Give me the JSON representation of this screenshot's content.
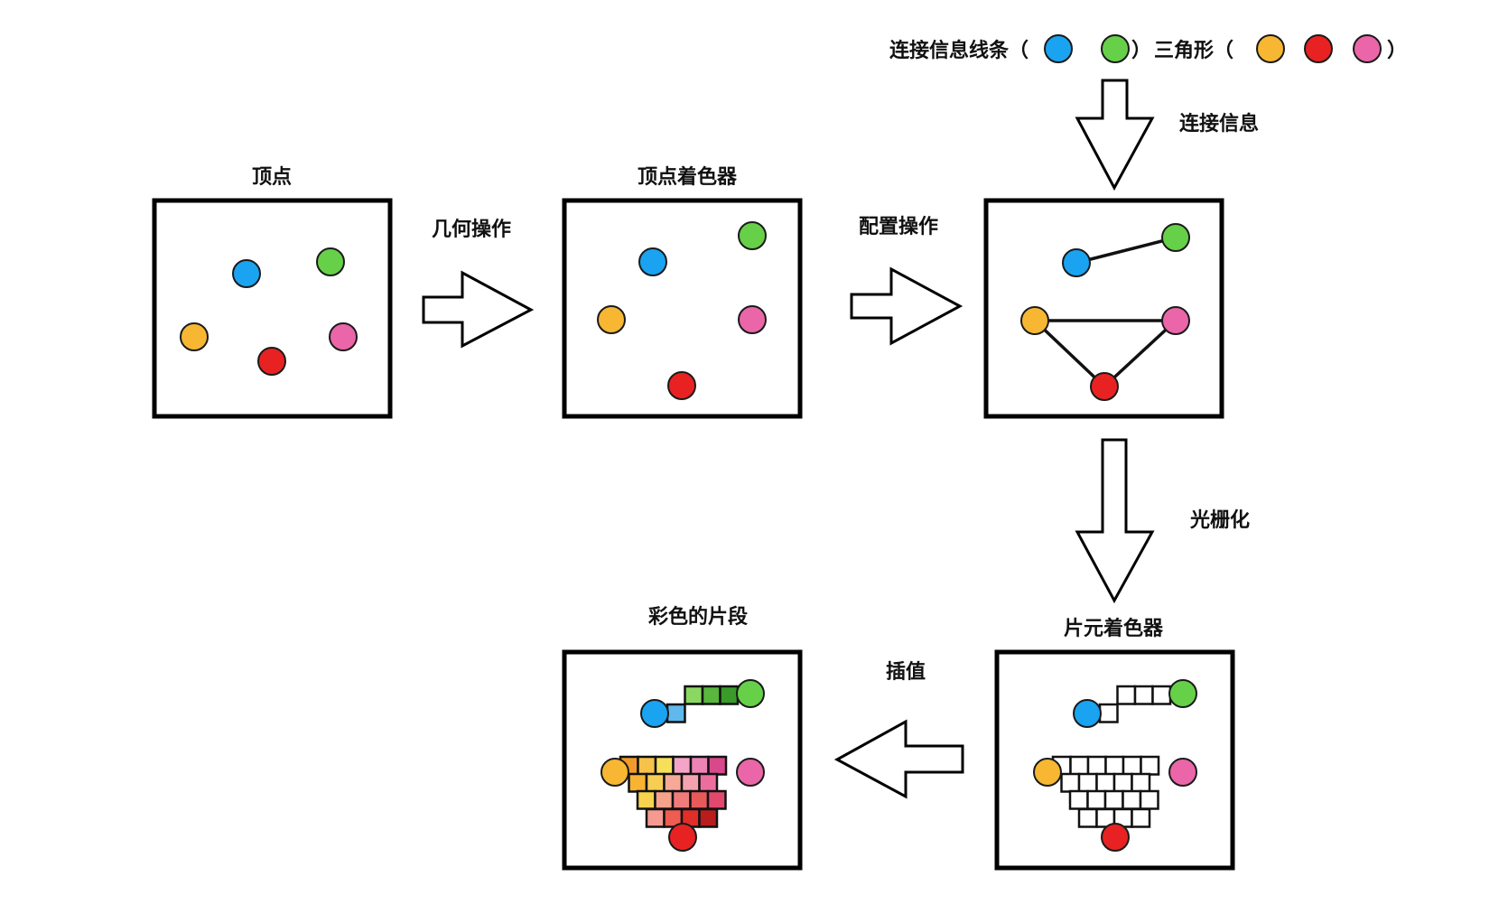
{
  "colors": {
    "blue": "#1aa3f0",
    "green": "#66d048",
    "orange": "#f7b733",
    "red": "#e82222",
    "pink": "#ea66a8"
  },
  "legend": {
    "lines_label": "连接信息线条（",
    "lines_close": "）",
    "triangle_label": "三角形（",
    "triangle_close": "）",
    "line_vertices": [
      "blue",
      "green"
    ],
    "triangle_vertices": [
      "orange",
      "red",
      "pink"
    ]
  },
  "stages": {
    "vertices": {
      "title": "顶点"
    },
    "vertex_shader": {
      "title": "顶点着色器"
    },
    "primitive_assembly": {
      "title": ""
    },
    "fragment_shader": {
      "title": "片元着色器"
    },
    "colored_fragments": {
      "title": "彩色的片段"
    }
  },
  "arrows": {
    "geometry": {
      "label": "几何操作",
      "direction": "right"
    },
    "config": {
      "label": "配置操作",
      "direction": "right"
    },
    "connection": {
      "label": "连接信息",
      "direction": "down"
    },
    "rasterize": {
      "label": "光栅化",
      "direction": "down"
    },
    "interpolate": {
      "label": "插值",
      "direction": "left"
    }
  },
  "fragment_colors": {
    "line": [
      "#60b8ec",
      "#8ad862",
      "#58b73c",
      "#3a9a2a"
    ],
    "row1": [
      "#f39a2c",
      "#f7c24a",
      "#f6e05a",
      "#f4a4c6",
      "#ee82b4",
      "#d8488a"
    ],
    "row2": [
      "#f7b430",
      "#f7ce54",
      "#f7a998",
      "#f5a2b0",
      "#ec6e9e"
    ],
    "row3": [
      "#f6d24e",
      "#f6a38c",
      "#f07b7b",
      "#e85a5a",
      "#e0486e"
    ],
    "row4": [
      "#f49a90",
      "#ee5c52",
      "#e02e28",
      "#b81c1c"
    ]
  }
}
